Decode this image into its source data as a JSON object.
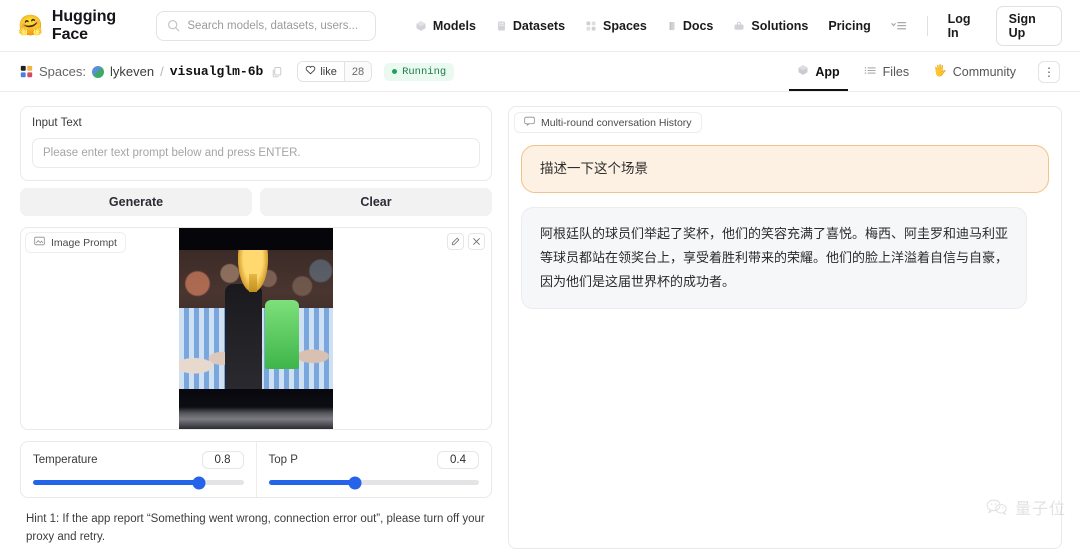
{
  "header": {
    "brand": "Hugging Face",
    "brand_logo_icon": "hugging-face-emoji",
    "search": {
      "placeholder": "Search models, datasets, users...",
      "value": "",
      "icon": "search-icon"
    },
    "nav": [
      {
        "label": "Models",
        "icon": "cube-icon"
      },
      {
        "label": "Datasets",
        "icon": "database-icon"
      },
      {
        "label": "Spaces",
        "icon": "grid-apps-icon"
      },
      {
        "label": "Docs",
        "icon": "book-icon"
      },
      {
        "label": "Solutions",
        "icon": "briefcase-icon"
      },
      {
        "label": "Pricing",
        "icon": ""
      }
    ],
    "more_menu_icon": "chevron-down-list-icon",
    "login_label": "Log In",
    "signup_label": "Sign Up"
  },
  "space": {
    "spaces_icon": "spaces-grid-icon",
    "spaces_label": "Spaces:",
    "owner": "lykeven",
    "separator": "/",
    "repo": "visualglm-6b",
    "copy_icon": "copy-icon",
    "like_label": "like",
    "like_icon": "heart-icon",
    "like_count": "28",
    "status": "Running",
    "tabs": [
      {
        "label": "App",
        "icon": "cube-icon",
        "active": true
      },
      {
        "label": "Files",
        "icon": "files-icon",
        "active": false
      },
      {
        "label": "Community",
        "icon": "community-hand-icon",
        "active": false
      }
    ],
    "kebab_icon": "kebab-menu-icon"
  },
  "left": {
    "input_label": "Input Text",
    "input_placeholder": "Please enter text prompt below and press ENTER.",
    "input_value": "",
    "generate_label": "Generate",
    "clear_label": "Clear",
    "image_prompt_label": "Image Prompt",
    "image_prompt_icon": "image-icon",
    "image_edit_icon": "pencil-icon",
    "image_close_icon": "close-icon",
    "image_alt": "Argentina players lifting the World Cup trophy on the podium",
    "sliders": [
      {
        "label": "Temperature",
        "value": "0.8",
        "percent": 79
      },
      {
        "label": "Top P",
        "value": "0.4",
        "percent": 41
      }
    ],
    "hint": "Hint 1: If the app report “Something went wrong, connection error out”, please turn off your proxy and retry."
  },
  "right": {
    "history_label": "Multi-round conversation History",
    "history_icon": "chat-bubble-icon",
    "messages": [
      {
        "role": "user",
        "text": "描述一下这个场景"
      },
      {
        "role": "assistant",
        "text": "阿根廷队的球员们举起了奖杯，他们的笑容充满了喜悦。梅西、阿圭罗和迪马利亚等球员都站在领奖台上，享受着胜利带来的荣耀。他们的脸上洋溢着自信与自豪，因为他们是这届世界杯的成功者。"
      }
    ]
  },
  "watermark": {
    "text": "量子位",
    "icon": "wechat-icon"
  },
  "colors": {
    "accent_blue": "#2563eb",
    "status_green": "#1fa25e",
    "user_bubble_bg": "#fdf1e3",
    "user_bubble_border": "#f2c28a",
    "bot_bubble_bg": "#f6f7f9"
  }
}
